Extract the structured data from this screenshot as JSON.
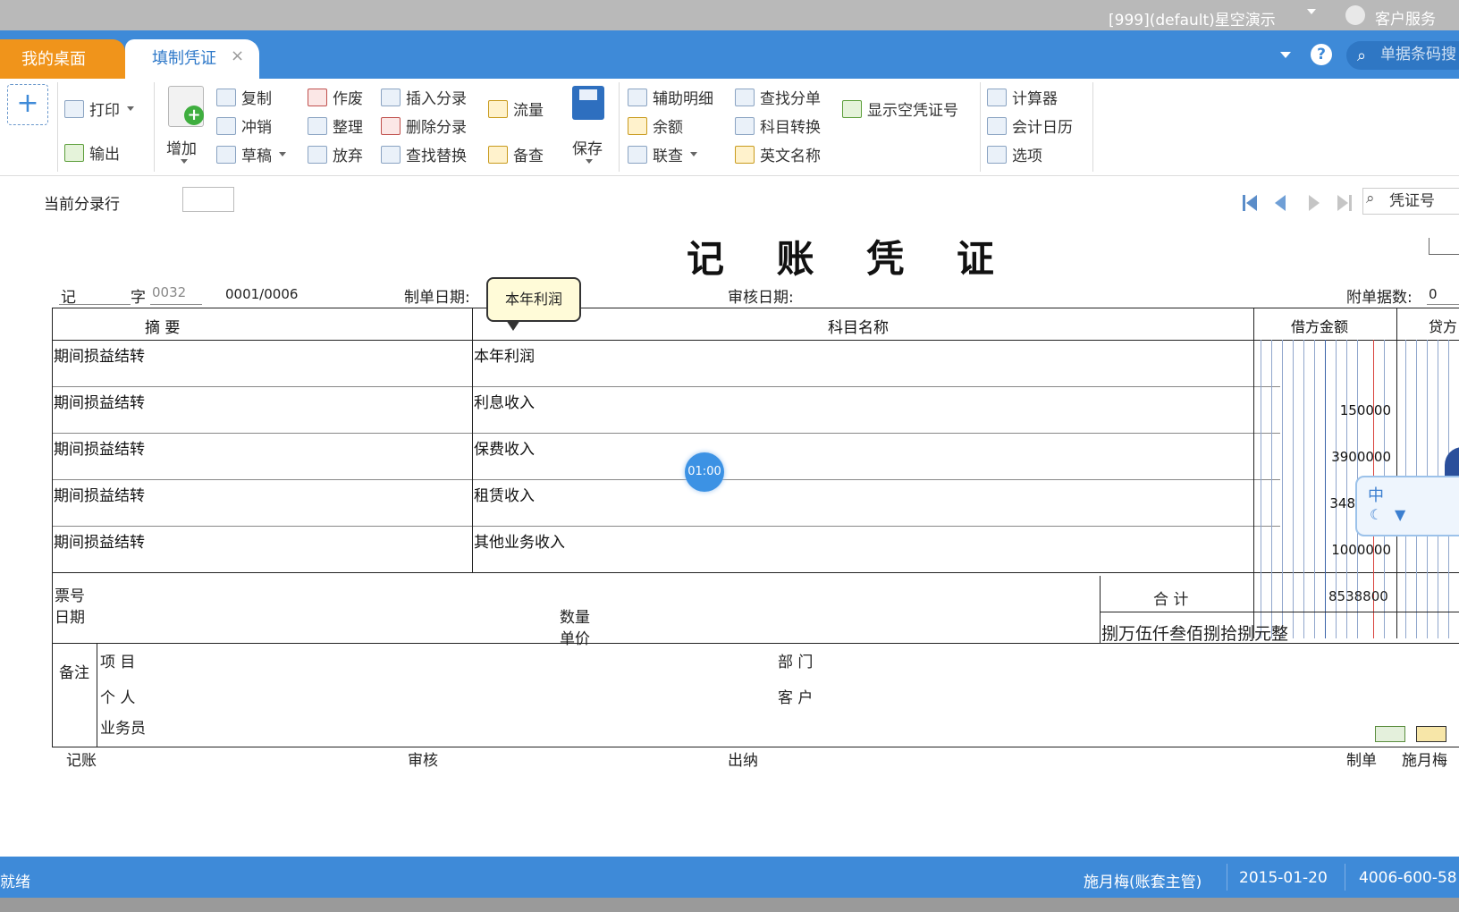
{
  "topbar": {
    "account": "[999](default)星空演示",
    "service": "客户服务"
  },
  "tabs": {
    "desk": "我的桌面",
    "voucher": "填制凭证",
    "close": "×"
  },
  "tabbar": {
    "help": "?",
    "search_placeholder": "单据条码搜"
  },
  "toolbar": {
    "print": "打印",
    "export": "输出",
    "add": "增加",
    "copy": "复制",
    "reverse": "冲销",
    "draft": "草稿",
    "void": "作废",
    "tidy": "整理",
    "abandon": "放弃",
    "insert_entry": "插入分录",
    "delete_entry": "删除分录",
    "find_replace": "查找替换",
    "flow": "流量",
    "reference": "备查",
    "save": "保存",
    "aux_detail": "辅助明细",
    "balance": "余额",
    "linked_query": "联查",
    "find_entry": "查找分单",
    "account_convert": "科目转换",
    "english_name": "英文名称",
    "show_empty_no": "显示空凭证号",
    "calculator": "计算器",
    "fiscal_calendar": "会计日历",
    "options": "选项"
  },
  "form": {
    "current_entry_label": "当前分录行",
    "voucher_no_placeholder": "凭证号",
    "title": "记 账 凭 证",
    "type": "记",
    "zi": "字",
    "number": "0032",
    "page": "0001/0006",
    "make_date_label": "制单日期:",
    "audit_date_label": "审核日期:",
    "attachments_label": "附单据数:",
    "attachments": "0"
  },
  "tooltip": "本年利润",
  "table": {
    "headers": {
      "summary": "摘 要",
      "account": "科目名称",
      "debit": "借方金额",
      "credit": "贷方"
    },
    "rows": [
      {
        "summary": "期间损益结转",
        "account": "本年利润",
        "debit": ""
      },
      {
        "summary": "期间损益结转",
        "account": "利息收入",
        "debit": "150000"
      },
      {
        "summary": "期间损益结转",
        "account": "保费收入",
        "debit": "3900000"
      },
      {
        "summary": "期间损益结转",
        "account": "租赁收入",
        "debit": "348"
      },
      {
        "summary": "期间损益结转",
        "account": "其他业务收入",
        "debit": "1000000"
      }
    ],
    "ticket_no": "票号",
    "date": "日期",
    "quantity": "数量",
    "unit_price": "单价",
    "total_label": "合 计",
    "total_value": "8538800",
    "total_words": "捌万伍仟叁佰捌拾捌元整",
    "remarks": "备注",
    "project": "项 目",
    "department": "部 门",
    "person": "个 人",
    "customer": "客 户",
    "salesman": "业务员"
  },
  "signatures": {
    "post": "记账",
    "audit": "审核",
    "cashier": "出纳",
    "maker": "制单",
    "maker_name": "施月梅"
  },
  "timer": "01:00",
  "ime": {
    "zh": "中"
  },
  "status": {
    "ready": "就绪",
    "user": "施月梅(账套主管)",
    "date": "2015-01-20",
    "phone": "4006-600-58"
  }
}
